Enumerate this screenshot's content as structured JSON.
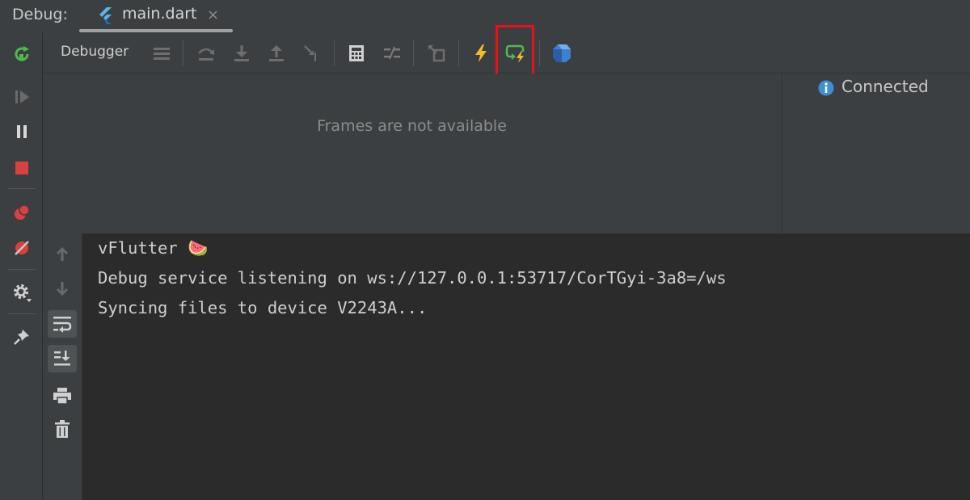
{
  "titlebar": {
    "label": "Debug:",
    "tab_name": "main.dart",
    "close_glyph": "×"
  },
  "toolbar": {
    "debugger_label": "Debugger",
    "icons": [
      "layout-icon",
      "step-over-icon",
      "step-into-icon",
      "step-out-icon",
      "run-to-cursor-icon",
      "evaluate-icon",
      "trace-icon",
      "drop-frame-icon",
      "hot-reload-icon",
      "hot-restart-icon",
      "dart-devtools-icon"
    ],
    "highlight_color": "#e8111b"
  },
  "frames": {
    "message": "Frames are not available"
  },
  "variables": {
    "status": "Connected"
  },
  "console": {
    "lines": [
      "vFlutter 🍉",
      "Debug service listening on ws://127.0.0.1:53717/CorTGyi-3a8=/ws",
      "Syncing files to device V2243A..."
    ]
  },
  "colors": {
    "accent_green": "#4fba4f",
    "stop_red": "#d9413f",
    "bolt_yellow": "#f4b92c",
    "info_blue": "#3d8fd9"
  }
}
